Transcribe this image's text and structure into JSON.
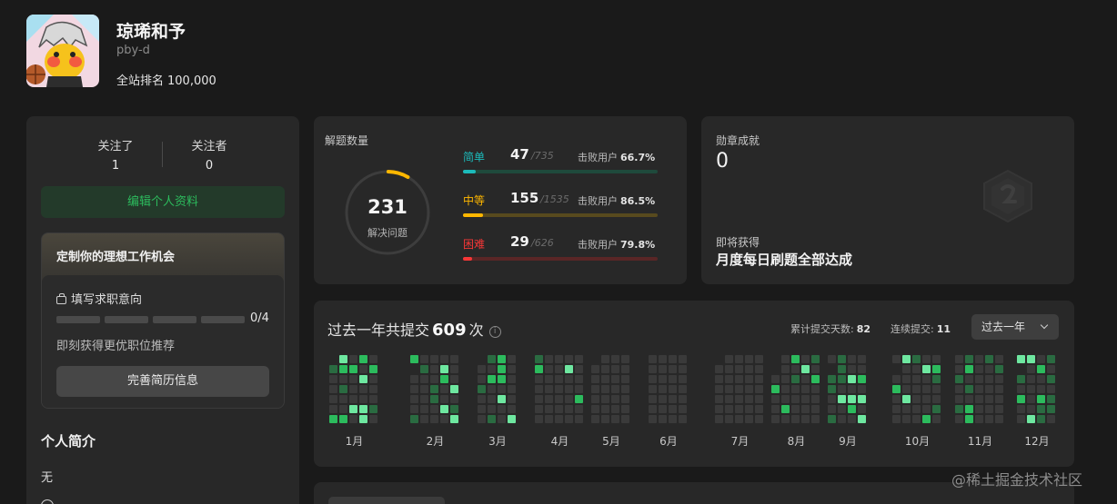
{
  "profile": {
    "name": "琼琋和予",
    "handle": "pby-d",
    "rank_label": "全站排名",
    "rank_value": "100,000"
  },
  "follow": {
    "following_label": "关注了",
    "following_count": "1",
    "followers_label": "关注者",
    "followers_count": "0"
  },
  "edit_profile_label": "编辑个人资料",
  "job": {
    "title": "定制你的理想工作机会",
    "subtitle": "填写求职意向",
    "progress_text": "0/4",
    "progress": 0,
    "hint": "即刻获得更优职位推荐",
    "button_label": "完善简历信息"
  },
  "intro": {
    "title": "个人简介",
    "value": "无"
  },
  "solved": {
    "label": "解题数量",
    "total": "231",
    "total_label": "解决问题",
    "difficulties": [
      {
        "name": "简单",
        "solved": "47",
        "total": "/735",
        "beat_label": "击败用户",
        "beat": "66.7%",
        "color": "#1cbaba",
        "track": "#1f4a3c"
      },
      {
        "name": "中等",
        "solved": "155",
        "total": "/1535",
        "beat_label": "击败用户",
        "beat": "86.5%",
        "color": "#ffb700",
        "track": "#584a1e"
      },
      {
        "name": "困难",
        "solved": "29",
        "total": "/626",
        "beat_label": "击败用户",
        "beat": "79.8%",
        "color": "#f63737",
        "track": "#5a2626"
      }
    ]
  },
  "badges": {
    "label": "勋章成就",
    "count": "0",
    "upcoming_label": "即将获得",
    "upcoming_name": "月度每日刷题全部达成",
    "icon": "badge-hexagon-icon"
  },
  "submissions": {
    "title_prefix": "过去一年共提交",
    "count": "609",
    "title_suffix": "次",
    "info_icon": "info-icon",
    "total_days_label": "累计提交天数:",
    "total_days": "82",
    "streak_label": "连续提交:",
    "streak": "11",
    "range": "过去一年",
    "months": [
      "1月",
      "2月",
      "3月",
      "4月",
      "5月",
      "6月",
      "7月",
      "8月",
      "9月",
      "10月",
      "11月",
      "12月"
    ]
  },
  "watermark": "@稀土掘金技术社区"
}
